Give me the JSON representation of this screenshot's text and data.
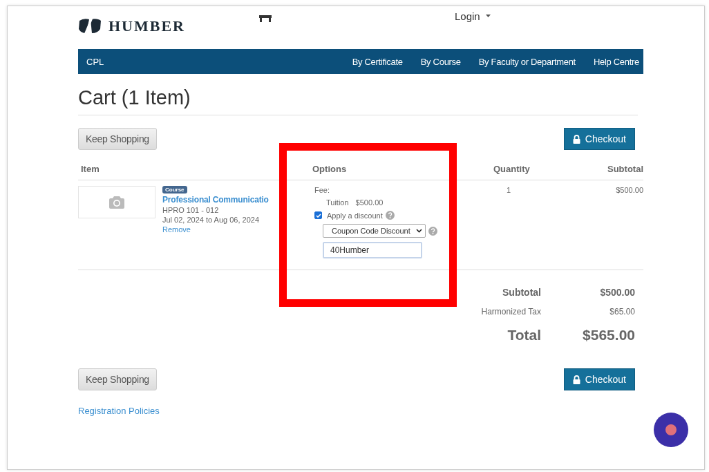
{
  "header": {
    "logo_text": "HUMBER",
    "login": "Login"
  },
  "nav": {
    "brand": "CPL",
    "links": [
      "By Certificate",
      "By Course",
      "By Faculty or Department",
      "Help Centre"
    ]
  },
  "title": "Cart (1 Item)",
  "top_actions": {
    "keep_shopping": "Keep Shopping",
    "checkout": "Checkout"
  },
  "table": {
    "columns": [
      "Item",
      "Options",
      "Quantity",
      "Subtotal"
    ],
    "rows": [
      {
        "badge": "Course",
        "name": "Professional Communicatio",
        "code": "HPRO 101 - 012",
        "dates": "Jul 02, 2024 to Aug 06, 2024",
        "remove": "Remove",
        "fee_label": "Fee:",
        "fee_name": "Tuition",
        "fee_amount": "$500.00",
        "discount": {
          "label": "Apply a discount",
          "checked": true
        },
        "discount_type": "Coupon Code Discount",
        "coupon": "40Humber",
        "quantity": "1",
        "subtotal": "$500.00"
      }
    ]
  },
  "totals": [
    {
      "kind": "subtotal",
      "label": "Subtotal",
      "value": "$500.00"
    },
    {
      "kind": "tax",
      "label": "Harmonized Tax",
      "value": "$65.00"
    },
    {
      "kind": "total",
      "label": "Total",
      "value": "$565.00"
    }
  ],
  "bottom_actions": {
    "keep_shopping": "Keep Shopping",
    "checkout": "Checkout"
  },
  "footer_link": "Registration Policies"
}
